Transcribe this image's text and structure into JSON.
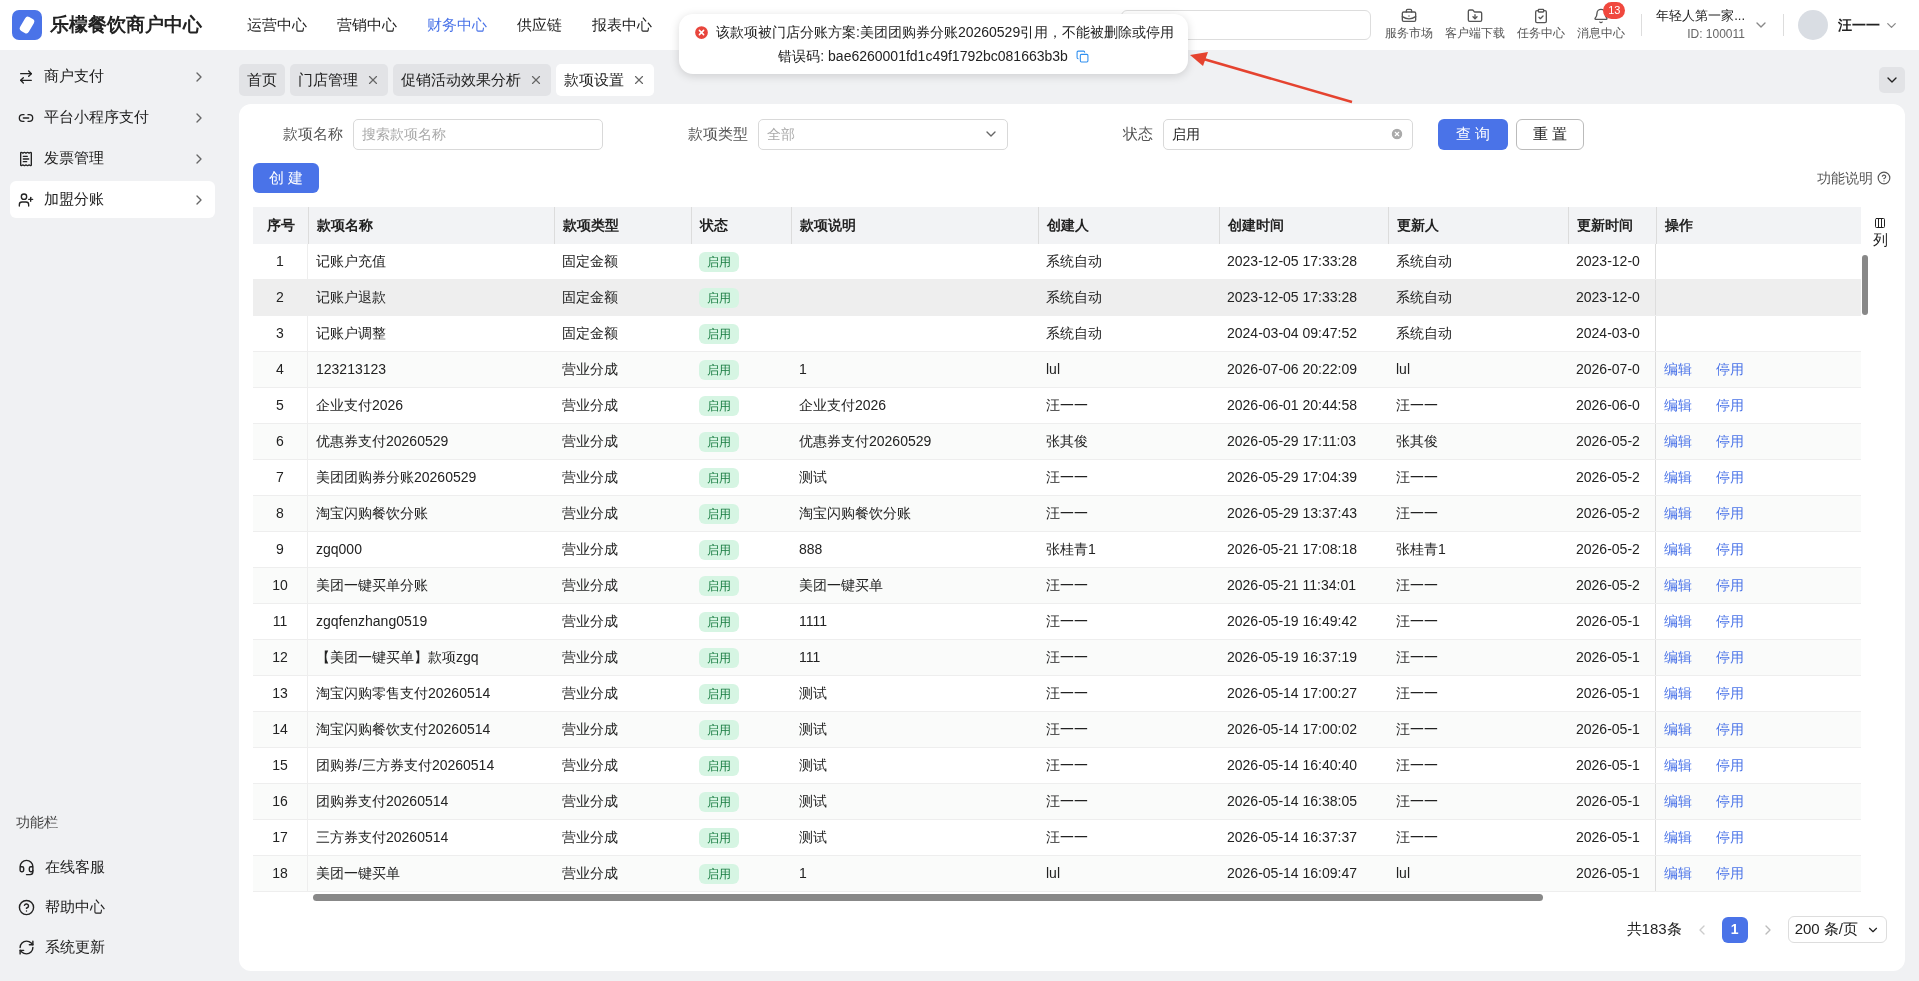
{
  "app": {
    "title": "乐檬餐饮商户中心"
  },
  "nav": [
    {
      "label": "运营中心",
      "selected": false
    },
    {
      "label": "营销中心",
      "selected": false
    },
    {
      "label": "财务中心",
      "selected": true
    },
    {
      "label": "供应链",
      "selected": false
    },
    {
      "label": "报表中心",
      "selected": false
    }
  ],
  "header_tools": [
    {
      "kind": "market",
      "label": "服务市场"
    },
    {
      "kind": "download",
      "label": "客户端下载"
    },
    {
      "kind": "task",
      "label": "任务中心"
    },
    {
      "kind": "message",
      "label": "消息中心",
      "badge": "13"
    }
  ],
  "account": {
    "store": "年轻人第一家...",
    "id": "ID: 100011",
    "user": "汪一一"
  },
  "toast": {
    "message": "该款项被门店分账方案:美团团购券分账20260529引用，不能被删除或停用",
    "code": "错误码: bae6260001fd1c49f1792bc081663b3b"
  },
  "sidebar": {
    "items": [
      {
        "kind": "transfer",
        "label": "商户支付",
        "selected": false
      },
      {
        "kind": "miniapp",
        "label": "平台小程序支付",
        "selected": false
      },
      {
        "kind": "invoice",
        "label": "发票管理",
        "selected": false
      },
      {
        "kind": "partner",
        "label": "加盟分账",
        "selected": true
      }
    ],
    "footer_title": "功能栏",
    "footer_items": [
      {
        "kind": "service",
        "label": "在线客服"
      },
      {
        "kind": "help",
        "label": "帮助中心"
      },
      {
        "kind": "update",
        "label": "系统更新"
      }
    ]
  },
  "tabs": [
    {
      "label": "首页",
      "closable": false,
      "selected": false
    },
    {
      "label": "门店管理",
      "closable": true,
      "selected": false
    },
    {
      "label": "促销活动效果分析",
      "closable": true,
      "selected": false
    },
    {
      "label": "款项设置",
      "closable": true,
      "selected": true
    }
  ],
  "filters": [
    {
      "kind": "input",
      "label": "款项名称",
      "placeholder": "搜索款项名称"
    },
    {
      "kind": "select",
      "label": "款项类型",
      "placeholder": "全部"
    },
    {
      "kind": "clearable",
      "label": "状态",
      "value": "启用"
    }
  ],
  "buttons": {
    "query": "查 询",
    "reset": "重 置",
    "create": "创 建",
    "help": "功能说明"
  },
  "table": {
    "columns": [
      "序号",
      "款项名称",
      "款项类型",
      "状态",
      "款项说明",
      "创建人",
      "创建时间",
      "更新人",
      "更新时间",
      "操作"
    ],
    "column_picker": "列",
    "rows": [
      {
        "cells": [
          "1",
          "记账户充值",
          "固定金额",
          "启用",
          "",
          "系统自动",
          "2023-12-05 17:33:28",
          "系统自动",
          "2023-12-0"
        ],
        "actions": [],
        "highlighted": false
      },
      {
        "cells": [
          "2",
          "记账户退款",
          "固定金额",
          "启用",
          "",
          "系统自动",
          "2023-12-05 17:33:28",
          "系统自动",
          "2023-12-0"
        ],
        "actions": [],
        "highlighted": true
      },
      {
        "cells": [
          "3",
          "记账户调整",
          "固定金额",
          "启用",
          "",
          "系统自动",
          "2024-03-04 09:47:52",
          "系统自动",
          "2024-03-0"
        ],
        "actions": [],
        "highlighted": false
      },
      {
        "cells": [
          "4",
          "123213123",
          "营业分成",
          "启用",
          "1",
          "lul",
          "2026-07-06 20:22:09",
          "lul",
          "2026-07-0"
        ],
        "actions": [
          "编辑",
          "停用"
        ],
        "highlighted": false
      },
      {
        "cells": [
          "5",
          "企业支付2026",
          "营业分成",
          "启用",
          "企业支付2026",
          "汪一一",
          "2026-06-01 20:44:58",
          "汪一一",
          "2026-06-0"
        ],
        "actions": [
          "编辑",
          "停用"
        ],
        "highlighted": false
      },
      {
        "cells": [
          "6",
          "优惠券支付20260529",
          "营业分成",
          "启用",
          "优惠券支付20260529",
          "张其俊",
          "2026-05-29 17:11:03",
          "张其俊",
          "2026-05-2"
        ],
        "actions": [
          "编辑",
          "停用"
        ],
        "highlighted": false
      },
      {
        "cells": [
          "7",
          "美团团购券分账20260529",
          "营业分成",
          "启用",
          "测试",
          "汪一一",
          "2026-05-29 17:04:39",
          "汪一一",
          "2026-05-2"
        ],
        "actions": [
          "编辑",
          "停用"
        ],
        "highlighted": false
      },
      {
        "cells": [
          "8",
          "淘宝闪购餐饮分账",
          "营业分成",
          "启用",
          "淘宝闪购餐饮分账",
          "汪一一",
          "2026-05-29 13:37:43",
          "汪一一",
          "2026-05-2"
        ],
        "actions": [
          "编辑",
          "停用"
        ],
        "highlighted": false
      },
      {
        "cells": [
          "9",
          "zgq000",
          "营业分成",
          "启用",
          "888",
          "张桂青1",
          "2026-05-21 17:08:18",
          "张桂青1",
          "2026-05-2"
        ],
        "actions": [
          "编辑",
          "停用"
        ],
        "highlighted": false
      },
      {
        "cells": [
          "10",
          "美团一键买单分账",
          "营业分成",
          "启用",
          "美团一键买单",
          "汪一一",
          "2026-05-21 11:34:01",
          "汪一一",
          "2026-05-2"
        ],
        "actions": [
          "编辑",
          "停用"
        ],
        "highlighted": false
      },
      {
        "cells": [
          "11",
          "zgqfenzhang0519",
          "营业分成",
          "启用",
          "1111",
          "汪一一",
          "2026-05-19 16:49:42",
          "汪一一",
          "2026-05-1"
        ],
        "actions": [
          "编辑",
          "停用"
        ],
        "highlighted": false
      },
      {
        "cells": [
          "12",
          "【美团一键买单】款项zgq",
          "营业分成",
          "启用",
          "111",
          "汪一一",
          "2026-05-19 16:37:19",
          "汪一一",
          "2026-05-1"
        ],
        "actions": [
          "编辑",
          "停用"
        ],
        "highlighted": false
      },
      {
        "cells": [
          "13",
          "淘宝闪购零售支付20260514",
          "营业分成",
          "启用",
          "测试",
          "汪一一",
          "2026-05-14 17:00:27",
          "汪一一",
          "2026-05-1"
        ],
        "actions": [
          "编辑",
          "停用"
        ],
        "highlighted": false
      },
      {
        "cells": [
          "14",
          "淘宝闪购餐饮支付20260514",
          "营业分成",
          "启用",
          "测试",
          "汪一一",
          "2026-05-14 17:00:02",
          "汪一一",
          "2026-05-1"
        ],
        "actions": [
          "编辑",
          "停用"
        ],
        "highlighted": false
      },
      {
        "cells": [
          "15",
          "团购券/三方券支付20260514",
          "营业分成",
          "启用",
          "测试",
          "汪一一",
          "2026-05-14 16:40:40",
          "汪一一",
          "2026-05-1"
        ],
        "actions": [
          "编辑",
          "停用"
        ],
        "highlighted": false
      },
      {
        "cells": [
          "16",
          "团购券支付20260514",
          "营业分成",
          "启用",
          "测试",
          "汪一一",
          "2026-05-14 16:38:05",
          "汪一一",
          "2026-05-1"
        ],
        "actions": [
          "编辑",
          "停用"
        ],
        "highlighted": false
      },
      {
        "cells": [
          "17",
          "三方券支付20260514",
          "营业分成",
          "启用",
          "测试",
          "汪一一",
          "2026-05-14 16:37:37",
          "汪一一",
          "2026-05-1"
        ],
        "actions": [
          "编辑",
          "停用"
        ],
        "highlighted": false
      },
      {
        "cells": [
          "18",
          "美团一键买单",
          "营业分成",
          "启用",
          "1",
          "lul",
          "2026-05-14 16:09:47",
          "lul",
          "2026-05-1"
        ],
        "actions": [
          "编辑",
          "停用"
        ],
        "highlighted": false
      }
    ]
  },
  "pagination": {
    "total": "共183条",
    "pages": [
      {
        "label": "1",
        "selected": true
      }
    ],
    "page_size": "200 条/页"
  }
}
